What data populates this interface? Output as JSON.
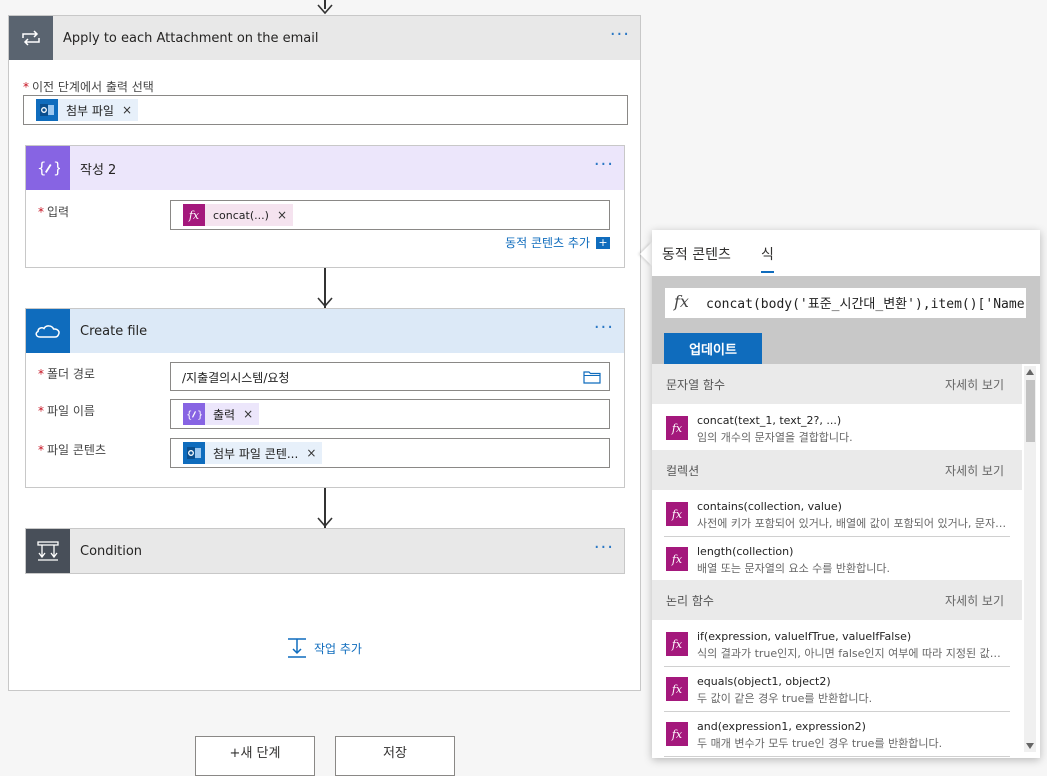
{
  "apply_each": {
    "title": "Apply to each Attachment on the email",
    "select_label": "이전 단계에서 출력 선택",
    "token_label": "첨부 파일"
  },
  "compose": {
    "title": "작성 2",
    "input_label": "입력",
    "token_label": "concat(...)",
    "dynamic_link": "동적 콘텐츠 추가"
  },
  "create_file": {
    "title": "Create file",
    "folder_label": "폴더 경로",
    "folder_value": "/지출결의시스템/요청",
    "filename_label": "파일 이름",
    "filename_token": "출력",
    "content_label": "파일 콘텐츠",
    "content_token": "첨부 파일 콘텐..."
  },
  "condition": {
    "title": "Condition"
  },
  "add_action": "작업 추가",
  "bottom": {
    "new_step": "+새 단계",
    "save": "저장"
  },
  "expression_panel": {
    "tabs": [
      "동적 콘텐츠",
      "식"
    ],
    "active_tab": "식",
    "fx_symbol": "fx",
    "expression": "concat(body('표준_시간대_변환'),item()['Name'])",
    "update_button": "업데이트",
    "sections": [
      {
        "title": "문자열 함수",
        "more": "자세히 보기",
        "items": [
          {
            "name": "concat(text_1, text_2?, ...)",
            "desc": "임의 개수의 문자열을 결합합니다."
          }
        ]
      },
      {
        "title": "컬렉션",
        "more": "자세히 보기",
        "items": [
          {
            "name": "contains(collection, value)",
            "desc": "사전에 키가 포함되어 있거나, 배열에 값이 포함되어 있거나, 문자열에 하위 문자열이 포함되어 있는 경우 true를 반환합니다."
          },
          {
            "name": "length(collection)",
            "desc": "배열 또는 문자열의 요소 수를 반환합니다."
          }
        ]
      },
      {
        "title": "논리 함수",
        "more": "자세히 보기",
        "items": [
          {
            "name": "if(expression, valueIfTrue, valueIfFalse)",
            "desc": "식의 결과가 true인지, 아니면 false인지 여부에 따라 지정된 값을 반환합니다."
          },
          {
            "name": "equals(object1, object2)",
            "desc": "두 값이 같은 경우 true를 반환합니다."
          },
          {
            "name": "and(expression1, expression2)",
            "desc": "두 매개 변수가 모두 true인 경우 true를 반환합니다."
          }
        ]
      }
    ]
  },
  "colors": {
    "apply_header": "#e8e8e8",
    "apply_icon": "#5a6470",
    "compose_header": "#ece6fb",
    "compose_icon": "#8764e3",
    "onedrive_header": "#dce9f7",
    "onedrive_icon": "#0f6cbd",
    "condition_header": "#e8e8e8",
    "condition_icon": "#484f59",
    "fx_icon": "#a4187c",
    "accent": "#0f6cbd"
  }
}
